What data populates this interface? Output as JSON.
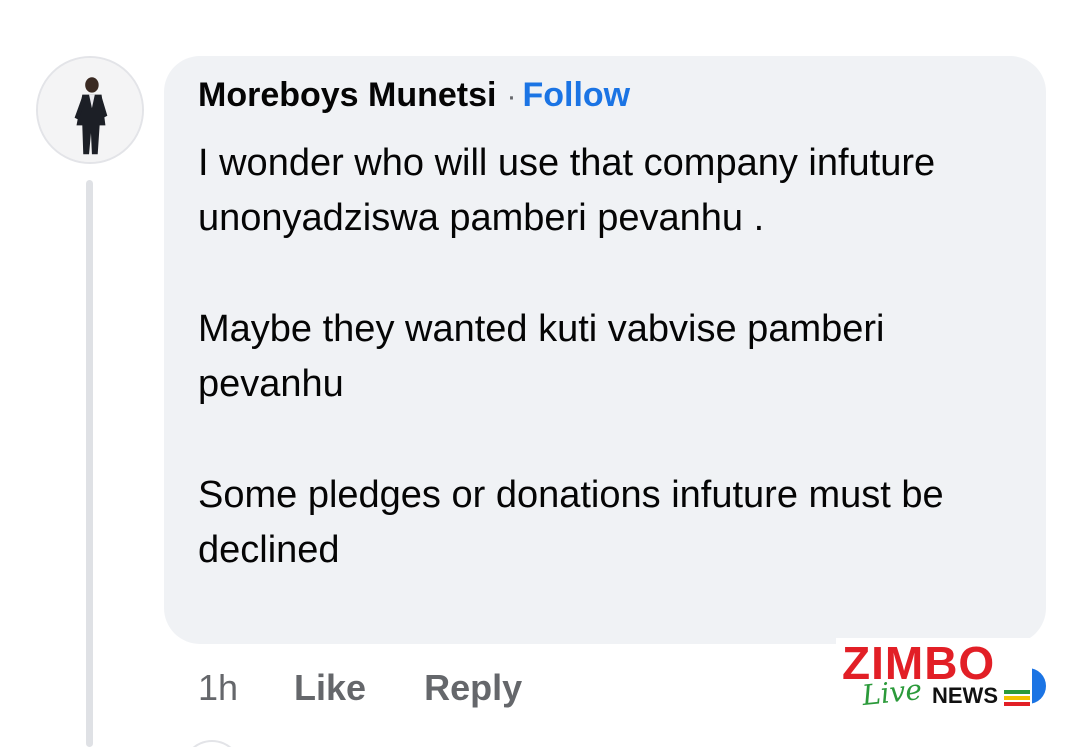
{
  "comment": {
    "author": "Moreboys Munetsi",
    "separator": "·",
    "follow_label": "Follow",
    "paragraphs": [
      "I wonder who will use that company infuture unonyadziswa pamberi pevanhu .",
      "Maybe they wanted kuti vabvise pamberi pevanhu",
      "Some pledges or donations infuture must be declined"
    ],
    "avatar_icon": "user-avatar-photo"
  },
  "actions": {
    "time": "1h",
    "like_label": "Like",
    "reply_label": "Reply"
  },
  "watermark": {
    "brand": "ZIMBO",
    "live": "Live",
    "news": "NEWS",
    "brand_color": "#e21f26",
    "live_color": "#2b9a3a"
  },
  "colors": {
    "bubble_bg": "#f0f2f5",
    "link_blue": "#1b74e4",
    "muted_text": "#65676b"
  }
}
